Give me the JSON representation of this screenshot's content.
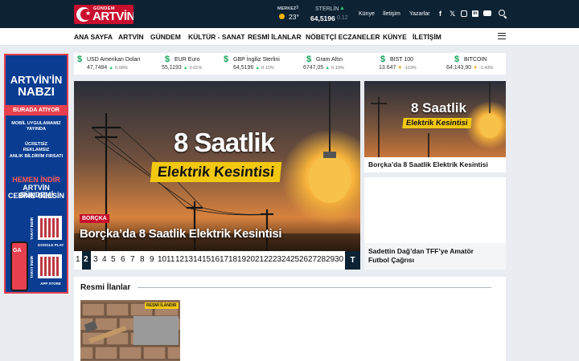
{
  "brand": {
    "small": "GÜNDEM",
    "big": "ARTVİN",
    "primary_color": "#c8102e",
    "dark_color": "#0d2233"
  },
  "weather": {
    "city": "MERKEZ",
    "temp": "23°"
  },
  "currency_top": {
    "name": "STERLİN",
    "value": "64,5196",
    "change": "0.12"
  },
  "top_links": [
    "Künye",
    "İletişim",
    "Yazarlar"
  ],
  "social_icons": [
    "facebook-icon",
    "x-icon",
    "instagram-icon",
    "linkedin-icon",
    "youtube-icon"
  ],
  "nav": [
    "ANA SAYFA",
    "ARTVİN",
    "GÜNDEM",
    "KÜLTÜR - SANAT",
    "RESMİ İLANLAR",
    "NÖBETÇİ ECZANELER",
    "KÜNYE",
    "İLETİŞİM"
  ],
  "ticker": [
    {
      "name": "USD Amerikan Doları",
      "value": "47,7484",
      "change": "0.08%",
      "dir": "up"
    },
    {
      "name": "EUR Euro",
      "value": "55,1193",
      "change": "0.01%",
      "dir": "up"
    },
    {
      "name": "GBP İngiliz Sterlini",
      "value": "64,5196",
      "change": "0.12%",
      "dir": "up"
    },
    {
      "name": "Gram Altın",
      "value": "6747,05",
      "change": "0.19%",
      "dir": "up"
    },
    {
      "name": "BIST 100",
      "value": "13.647",
      "change": "-119%",
      "dir": "down"
    },
    {
      "name": "BITCOIN",
      "value": "64.143,90",
      "change": "-1.43%",
      "dir": "down"
    }
  ],
  "ad": {
    "head1": "ARTVİN'İN",
    "head2": "NABZI",
    "band": "BURADA ATIYOR",
    "line1": "MOBİL UYGULAMAMIZ",
    "line2": "YAYINDA",
    "line3": "ÜCRETSİZ",
    "line4": "REKLAMSIZ",
    "line5": "ANLIK BİLDİRİM FIRSATI",
    "cta1": "HEMEN İNDİR",
    "cta2": "ARTVİN GÜNDEMİ",
    "cta3": "CEBİNE GELSİN",
    "phone": "GA",
    "scan1": "TARAT İNDİR",
    "scan2": "TARAT İNDİR",
    "store1": "GOOGLE PLAY",
    "store2": "APP STORE"
  },
  "hero": {
    "image_line1": "8 Saatlik",
    "image_line2": "Elektrik Kesintisi",
    "category": "BORÇKA",
    "title": "Borçka’da 8 Saatlik Elektrik Kesintisi"
  },
  "pager": {
    "pages": [
      "1",
      "2",
      "3",
      "4",
      "5",
      "6",
      "7",
      "8",
      "9",
      "10",
      "11",
      "12",
      "13",
      "14",
      "15",
      "16",
      "17",
      "18",
      "19",
      "20",
      "21",
      "22",
      "23",
      "24",
      "25",
      "26",
      "27",
      "28",
      "29",
      "30"
    ],
    "active": "2",
    "last": "T"
  },
  "side": [
    {
      "image_line1": "8 Saatlik",
      "image_line2": "Elektrik Kesintisi",
      "title": "Borçka’da 8 Saatlik Elektrik Kesintisi"
    },
    {
      "title_line1": "Sadettin Dağ’dan TFF’ye Amatör",
      "title_line2": "Futbol Çağrısı"
    }
  ],
  "resmi": {
    "title": "Resmi İlanlar",
    "badge": "RESMİ İLANDIR"
  }
}
